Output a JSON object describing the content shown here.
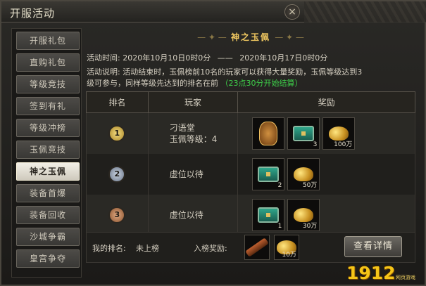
{
  "window": {
    "title": "开服活动",
    "close_glyph": "×"
  },
  "sidebar": {
    "items": [
      {
        "label": "开服礼包",
        "active": false
      },
      {
        "label": "直购礼包",
        "active": false
      },
      {
        "label": "等级竞技",
        "active": false
      },
      {
        "label": "签到有礼",
        "active": false
      },
      {
        "label": "等级冲榜",
        "active": false
      },
      {
        "label": "玉佩竞技",
        "active": false
      },
      {
        "label": "神之玉佩",
        "active": true
      },
      {
        "label": "装备首爆",
        "active": false
      },
      {
        "label": "装备回收",
        "active": false
      },
      {
        "label": "沙城争霸",
        "active": false
      },
      {
        "label": "皇宫争夺",
        "active": false
      }
    ]
  },
  "panel": {
    "title": "神之玉佩",
    "title_deco": "— ✦ —",
    "time_label": "活动时间:",
    "time_start": "2020年10月10日0时0分",
    "time_sep": "——",
    "time_end": "2020年10月17日0时0分",
    "desc_label": "活动说明:",
    "desc_line1": "活动结束时，玉佩榜前10名的玩家可以获得大量奖励，玉佩等级达到3",
    "desc_line2": "级可参与，同样等级先达到的排名在前",
    "desc_highlight": "（23点30分开始结算）"
  },
  "table": {
    "headers": {
      "rank": "排名",
      "player": "玩家",
      "reward": "奖励"
    },
    "rows": [
      {
        "medal": "1",
        "player_name": "刁语堂",
        "player_level": "玉佩等级：4",
        "rewards": [
          {
            "icon": "jade-pendant-icon",
            "qty": ""
          },
          {
            "icon": "treasure-chest-icon",
            "qty": "3"
          },
          {
            "icon": "gold-coins-icon",
            "qty": "100万"
          }
        ]
      },
      {
        "medal": "2",
        "player_name": "虚位以待",
        "player_level": "",
        "rewards": [
          {
            "icon": "treasure-chest-icon",
            "qty": "2"
          },
          {
            "icon": "gold-coins-icon",
            "qty": "50万"
          }
        ]
      },
      {
        "medal": "3",
        "player_name": "虚位以待",
        "player_level": "",
        "rewards": [
          {
            "icon": "treasure-chest-icon",
            "qty": "1"
          },
          {
            "icon": "gold-coins-icon",
            "qty": "30万"
          }
        ]
      }
    ]
  },
  "footer": {
    "my_rank_label": "我的排名:",
    "my_rank_value": "未上榜",
    "entry_reward_label": "入榜奖励:",
    "entry_rewards": [
      {
        "icon": "scroll-icon",
        "qty": ""
      },
      {
        "icon": "gold-coins-icon",
        "qty": "10万"
      }
    ],
    "details_button": "查看详情"
  },
  "branding": {
    "logo": "1912",
    "logo_sub": "网页游戏"
  }
}
